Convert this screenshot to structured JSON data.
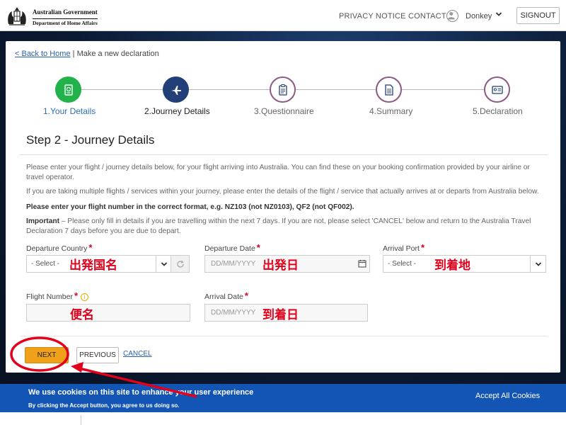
{
  "header": {
    "gov_name": "Australian Government",
    "dept_name": "Department of Home Affairs",
    "nav_privacy": "PRIVACY NOTICE",
    "nav_contact": "CONTACT",
    "user_name": "Donkey",
    "signout": "SIGNOUT"
  },
  "breadcrumb": {
    "back": "< Back to Home",
    "separator": " | ",
    "current": "Make a new declaration"
  },
  "steps": [
    {
      "label": "1.Your Details",
      "icon": "passport-icon",
      "state": "complete"
    },
    {
      "label": "2.Journey Details",
      "icon": "airplane-icon",
      "state": "current"
    },
    {
      "label": "3.Questionnaire",
      "icon": "clipboard-icon",
      "state": "pending"
    },
    {
      "label": "4.Summary",
      "icon": "document-icon",
      "state": "pending"
    },
    {
      "label": "5.Declaration",
      "icon": "id-card-icon",
      "state": "pending"
    }
  ],
  "form": {
    "title": "Step 2 - Journey Details",
    "para1": "Please enter your flight / journey details below, for your flight arriving into Australia. You can find these on your booking confirmation provided by your airline or travel operator.",
    "para2": "If you are taking multiple flights / services within your journey, please enter the details of the flight / service that actually arrives at or departs from Australia below.",
    "para3": "Please enter your flight number in the correct format, e.g. NZ103 (not NZ0103), QF2 (not QF002).",
    "para4_bold": "Important",
    "para4": " – Please only fill in details if you are travelling within the next 7 days.  If you are not, please select 'CANCEL' below and return to the Australia Travel Declaration 7 days before you are due to depart.",
    "departure_country_label": "Departure Country",
    "departure_country_value": "- Select -",
    "departure_date_label": "Departure Date",
    "departure_date_placeholder": "DD/MM/YYYY",
    "arrival_port_label": "Arrival Port",
    "arrival_port_value": "- Select -",
    "flight_number_label": "Flight Number",
    "flight_number_value": "",
    "arrival_date_label": "Arrival Date",
    "arrival_date_placeholder": "DD/MM/YYYY",
    "required_mark": "*",
    "info_mark": "i"
  },
  "buttons": {
    "next": "NEXT",
    "previous": "PREVIOUS",
    "cancel": "CANCEL"
  },
  "annotations": {
    "departure_country": "出発国名",
    "departure_date": "出発日",
    "arrival_port": "到着地",
    "flight_number": "便名",
    "arrival_date": "到着日",
    "color": "#e2001a"
  },
  "cookie": {
    "title": "We use cookies on this site to enhance your user experience",
    "subtitle": "By clicking the Accept button, you agree to us doing so.",
    "accept": "Accept All Cookies"
  },
  "colors": {
    "step_complete": "#21b24c",
    "step_current": "#233f78",
    "step_pending_border": "#8e5a82",
    "next_button": "#f0a019",
    "cookie_banner": "#1355b5",
    "link": "#2a5fad"
  }
}
